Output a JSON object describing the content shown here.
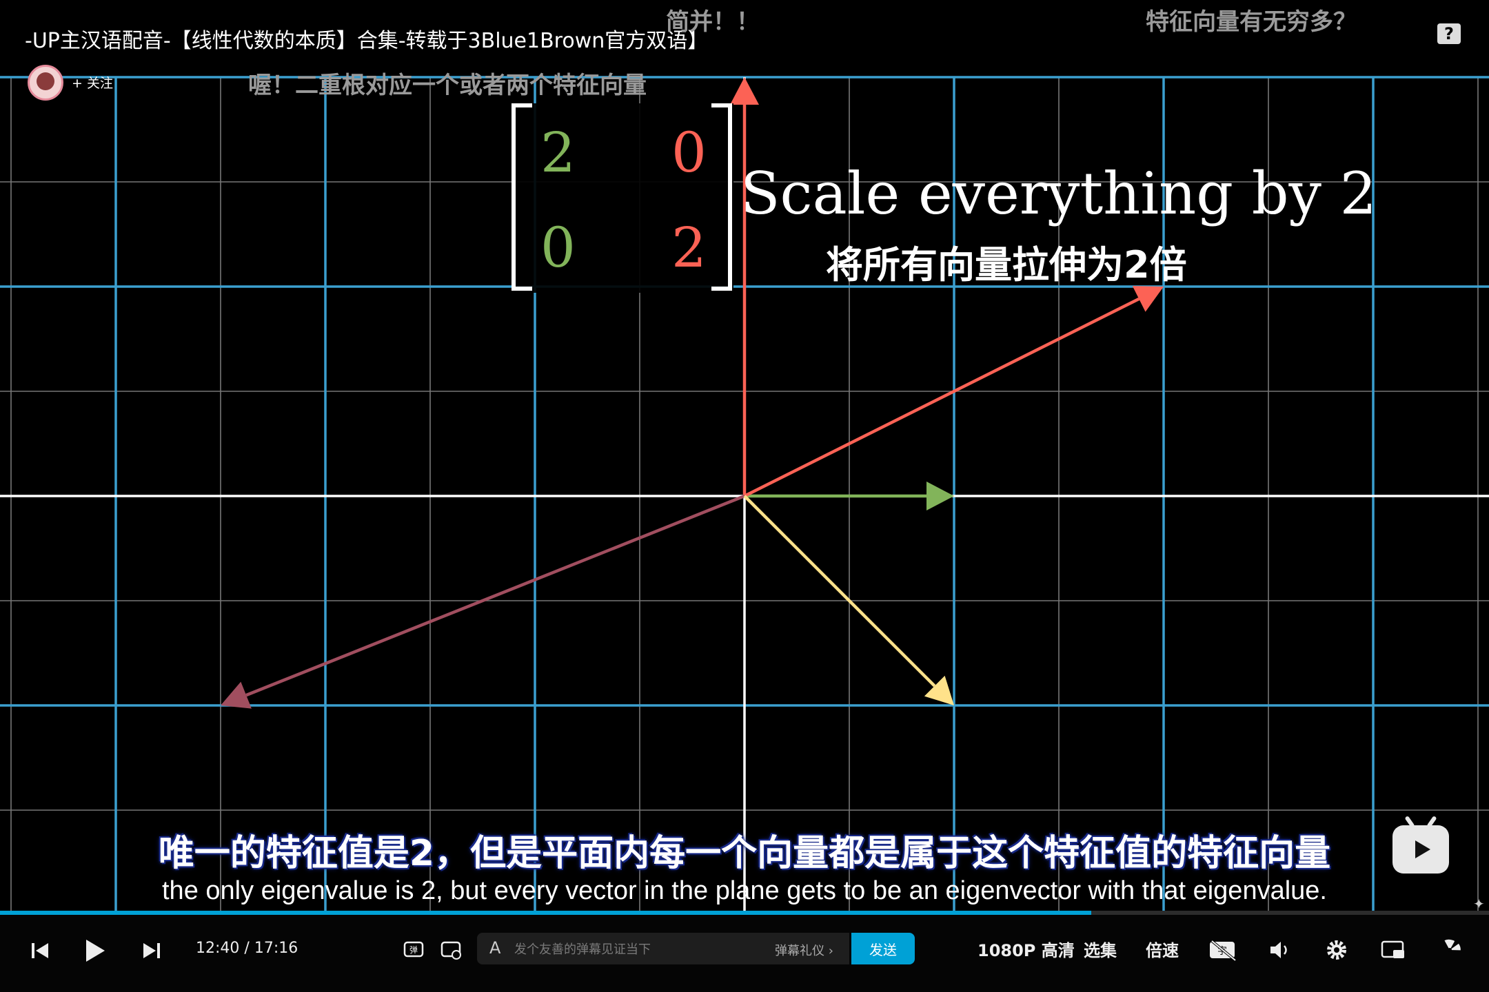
{
  "video": {
    "title": "-UP主汉语配音-【线性代数的本质】合集-转载于3Blue1Brown官方双语】",
    "follow_label": "+ 关注",
    "help_icon": "?"
  },
  "danmaku": [
    {
      "text": "简并！！"
    },
    {
      "text": "特征向量有无穷多？"
    },
    {
      "text": "喔！二重根对应一个或者两个特征向量"
    }
  ],
  "scene": {
    "matrix": {
      "a": "2",
      "b": "0",
      "c": "0",
      "d": "2"
    },
    "caption_en": "Scale everything by 2",
    "caption_cn": "将所有向量拉伸为2倍",
    "colors": {
      "green": "#82b45a",
      "red": "#fc6255",
      "maroon": "#a14e5f",
      "yellow": "#ffe28a",
      "grid_blue": "#3b9fcf"
    }
  },
  "subtitles": {
    "cn": "唯一的特征值是2，但是平面内每一个向量都是属于这个特征值的特征向量",
    "en": "the only eigenvalue is 2, but every vector in the plane gets to be an eigenvector with that eigenvalue."
  },
  "player": {
    "current_time": "12:40",
    "separator": "/",
    "duration": "17:16",
    "progress": 0.733,
    "danmaku_placeholder": "发个友善的弹幕见证当下",
    "danmaku_etiquette": "弹幕礼仪 ›",
    "send_label": "发送",
    "quality_label": "1080P 高清",
    "episodes_label": "选集",
    "speed_label": "倍速"
  }
}
